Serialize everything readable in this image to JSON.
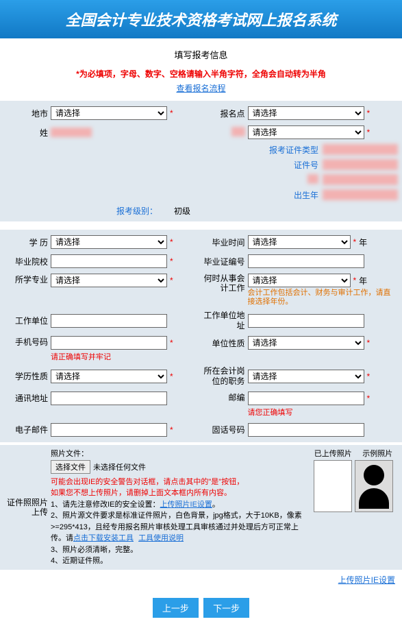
{
  "banner": {
    "title": "全国会计专业技术资格考试网上报名系统"
  },
  "section_title": "填写报考信息",
  "notice": "*为必填项，字母、数字、空格请输入半角字符，全角会自动转为半角",
  "view_flow": "查看报名流程",
  "select_placeholder": "请选择",
  "labels": {
    "city": "地市",
    "exam_point": "报名点",
    "name": "姓",
    "unknown_right1": "",
    "cert_type": "报考证件类型",
    "cert_no": "证件号",
    "blank1": "",
    "birth_year": "出生年",
    "exam_level": "报考级别：",
    "exam_level_val": "初级",
    "edu": "学 历",
    "grad_time": "毕业时间",
    "grad_school": "毕业院校",
    "grad_cert_no": "毕业证编号",
    "major": "所学专业",
    "work_since": "何时从事会计工作",
    "work_since_hint": "会计工作包括会计、财务与审计工作，请直接选择年份。",
    "work_unit": "工作单位",
    "unit_addr": "工作单位地址",
    "phone": "手机号码",
    "phone_hint": "请正确填写并牢记",
    "unit_nature": "单位性质",
    "edu_nature": "学历性质",
    "acc_position": "所在会计岗位的职务",
    "contact_addr": "通讯地址",
    "postcode": "邮编",
    "postcode_hint": "请您正确填写",
    "email": "电子邮件",
    "tel": "固话号码"
  },
  "photo": {
    "lbl": "证件照照片上传",
    "file_label": "照片文件：",
    "choose_btn": "选择文件",
    "no_file": "未选择任何文件",
    "warn1": "可能会出现IE的安全警告对话框，请点击其中的\"是\"按钮，",
    "warn2": "如果您不想上传照片，请删掉上面文本框内所有内容。",
    "li1_a": "1、请先注意修改IE的安全设置：",
    "li1_link": "上传照片IE设置",
    "li1_b": "。",
    "li2_a": "2、照片源文件要求是标准证件照片，白色背景，jpg格式，大于10KB，像素>=295*413，且经专用报名照片审核处理工具审核通过并处理后方可正常上传。请",
    "li2_link1": "点击下载安装工具",
    "li2_link2": "工具使用说明",
    "li3": "3、照片必须清晰，完整。",
    "li4": "4、近期证件照。",
    "uploaded": "已上传照片",
    "sample": "示例照片",
    "ie_setting": "上传照片IE设置"
  },
  "buttons": {
    "prev": "上一步",
    "next": "下一步"
  },
  "year_suffix": "年"
}
